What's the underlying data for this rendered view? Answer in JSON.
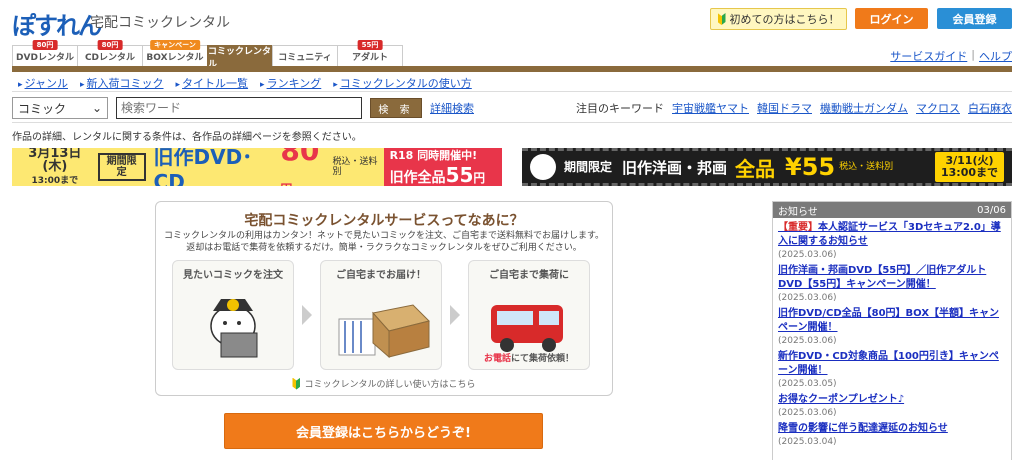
{
  "header": {
    "logo": "ぽすれん",
    "tagline": "宅配コミックレンタル",
    "first_time": "初めての方はこちら！",
    "login": "ログイン",
    "register": "会員登録"
  },
  "tabs": [
    {
      "label": "DVDレンタル",
      "badge": "80円"
    },
    {
      "label": "CDレンタル",
      "badge": "80円"
    },
    {
      "label": "BOXレンタル",
      "badge": "キャンペーン"
    },
    {
      "label": "コミックレンタル",
      "badge": ""
    },
    {
      "label": "コミュニティ",
      "badge": ""
    },
    {
      "label": "アダルト",
      "badge": "55円"
    }
  ],
  "top_links": {
    "guide": "サービスガイド",
    "sep": "|",
    "help": "ヘルプ"
  },
  "subnav": [
    "ジャンル",
    "新入荷コミック",
    "タイトル一覧",
    "ランキング",
    "コミックレンタルの使い方"
  ],
  "search": {
    "category": "コミック",
    "placeholder": "検索ワード",
    "button": "検 索",
    "advanced": "詳細検索",
    "kw_label": "注目のキーワード",
    "keywords": [
      "宇宙戦艦ヤマト",
      "韓国ドラマ",
      "機動戦士ガンダム",
      "マクロス",
      "白石麻衣"
    ]
  },
  "notice": "作品の詳細、レンタルに関する条件は、各作品の詳細ページを参照ください。",
  "banner_left": {
    "date": "3月13日(木)",
    "until": "13:00まで",
    "limited": "期間限定",
    "title": "旧作DVD･CD",
    "price": "80",
    "yen": "円",
    "tax": "税込・送料別",
    "r18": "R18",
    "ongoing": "同時開催中!",
    "all": "旧作全品",
    "price2": "55",
    "yen2": "円"
  },
  "banner_right": {
    "limited": "期間限定",
    "title": "旧作洋画・邦画",
    "all": "全品",
    "price": "¥55",
    "tax": "税込・送料別",
    "date": "3/11(火)",
    "until": "13:00まで"
  },
  "info": {
    "title": "宅配コミックレンタルサービスってなあに？",
    "desc1": "コミックレンタルの利用はカンタン！ネットで見たいコミックを注文、ご自宅まで送料無料でお届けします。",
    "desc2": "返却はお電話で集荷を依頼するだけ。簡単・ラクラクなコミックレンタルをぜひご利用ください。",
    "step1": "見たいコミックを注文",
    "step2": "ご自宅までお届け！",
    "step3": "ご自宅まで集荷に",
    "step3_note_hl": "お電話",
    "step3_note": "にて集荷依頼！",
    "howto": "コミックレンタルの詳しい使い方はこちら"
  },
  "signup": "会員登録はこちらからどうぞ!",
  "news": {
    "title": "お知らせ",
    "count": "03/06",
    "items": [
      {
        "tag": "【重要】",
        "text": "本人認証サービス「3Dセキュア2.0」導入に関するお知らせ",
        "date": "(2025.03.06)"
      },
      {
        "tag": "",
        "text": "旧作洋画・邦画DVD【55円】／旧作アダルトDVD【55円】キャンペーン開催！",
        "date": "(2025.03.06)"
      },
      {
        "tag": "",
        "text": "旧作DVD/CD全品【80円】BOX【半額】キャンペーン開催！",
        "date": "(2025.03.06)"
      },
      {
        "tag": "",
        "text": "新作DVD・CD対象商品【100円引き】キャンペーン開催！",
        "date": "(2025.03.05)"
      },
      {
        "tag": "",
        "text": "お得なクーポンプレゼント♪",
        "date": "(2025.03.06)"
      },
      {
        "tag": "",
        "text": "降雪の影響に伴う配達遅延のお知らせ",
        "date": "(2025.03.04)"
      }
    ]
  }
}
